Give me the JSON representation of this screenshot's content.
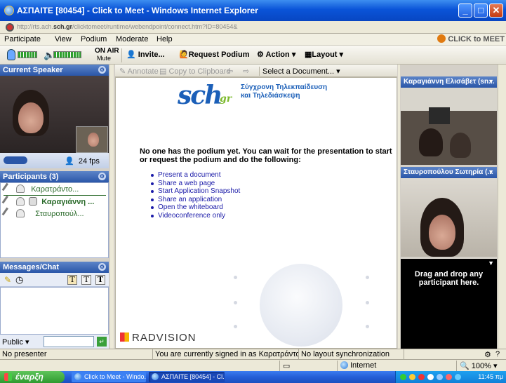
{
  "window": {
    "title": "ΑΣΠΑΙΤΕ [80454] - Click to Meet - Windows Internet Explorer"
  },
  "address": {
    "url_prefix": "http://rts.ach.",
    "url_host": "sch.gr",
    "url_path": "/clicktomeet/runtime/webendpoint/connect.htm?ID=80454&"
  },
  "menu": {
    "items": [
      "Participate",
      "View",
      "Podium",
      "Moderate",
      "Help"
    ],
    "brand": "CLICK to MEET"
  },
  "toolbar": {
    "on_air": "ON AIR",
    "mute": "Mute",
    "invite": "Invite...",
    "request_podium": "Request Podium",
    "action": "Action",
    "layout": "Layout"
  },
  "speaker": {
    "header": "Current Speaker",
    "fps_count": "24",
    "fps_unit": "fps"
  },
  "participants": {
    "header": "Participants (3)",
    "items": [
      "Καρατράντο...",
      "Καραγιάννη ...",
      "Σταυροπούλ..."
    ]
  },
  "messages": {
    "header": "Messages/Chat",
    "audience": "Public",
    "input_value": ""
  },
  "docbar": {
    "annotate": "Annotate",
    "copy": "Copy to Clipboard",
    "select_doc": "Select a Document..."
  },
  "content": {
    "logo_text": "sch",
    "logo_suffix": "gr",
    "logo_tag_line1": "Σύγχρονη Τηλεκπαίδευση",
    "logo_tag_line2": "και Τηλεδιάσκεψη",
    "podium_message": "No one has the podium yet. You can wait for the presentation to start or request the podium and do the following:",
    "options": [
      "Present a document",
      "Share a web page",
      "Start Application Snapshot",
      "Share an application",
      "Open the whiteboard",
      "Videoconference only"
    ],
    "vendor": "RADVISION"
  },
  "videos": {
    "pane1_name": "Καραγιάννη Ελισάβετ (sn...",
    "pane2_name": "Σταυροπούλου Σωτηρία (...",
    "drop_text": "Drag and drop any participant here."
  },
  "status": {
    "presenter": "No presenter",
    "signed_in": "You are currently signed in as Καρατράντου Ανθή",
    "sync": "No layout synchronization"
  },
  "ie_status": {
    "zone": "Internet",
    "zoom": "100%"
  },
  "taskbar": {
    "start": "έναρξη",
    "tasks": [
      "Click to Meet - Windo...",
      "ΑΣΠΑΙΤΕ [80454] - Cl..."
    ],
    "time": "11:45 πμ"
  }
}
